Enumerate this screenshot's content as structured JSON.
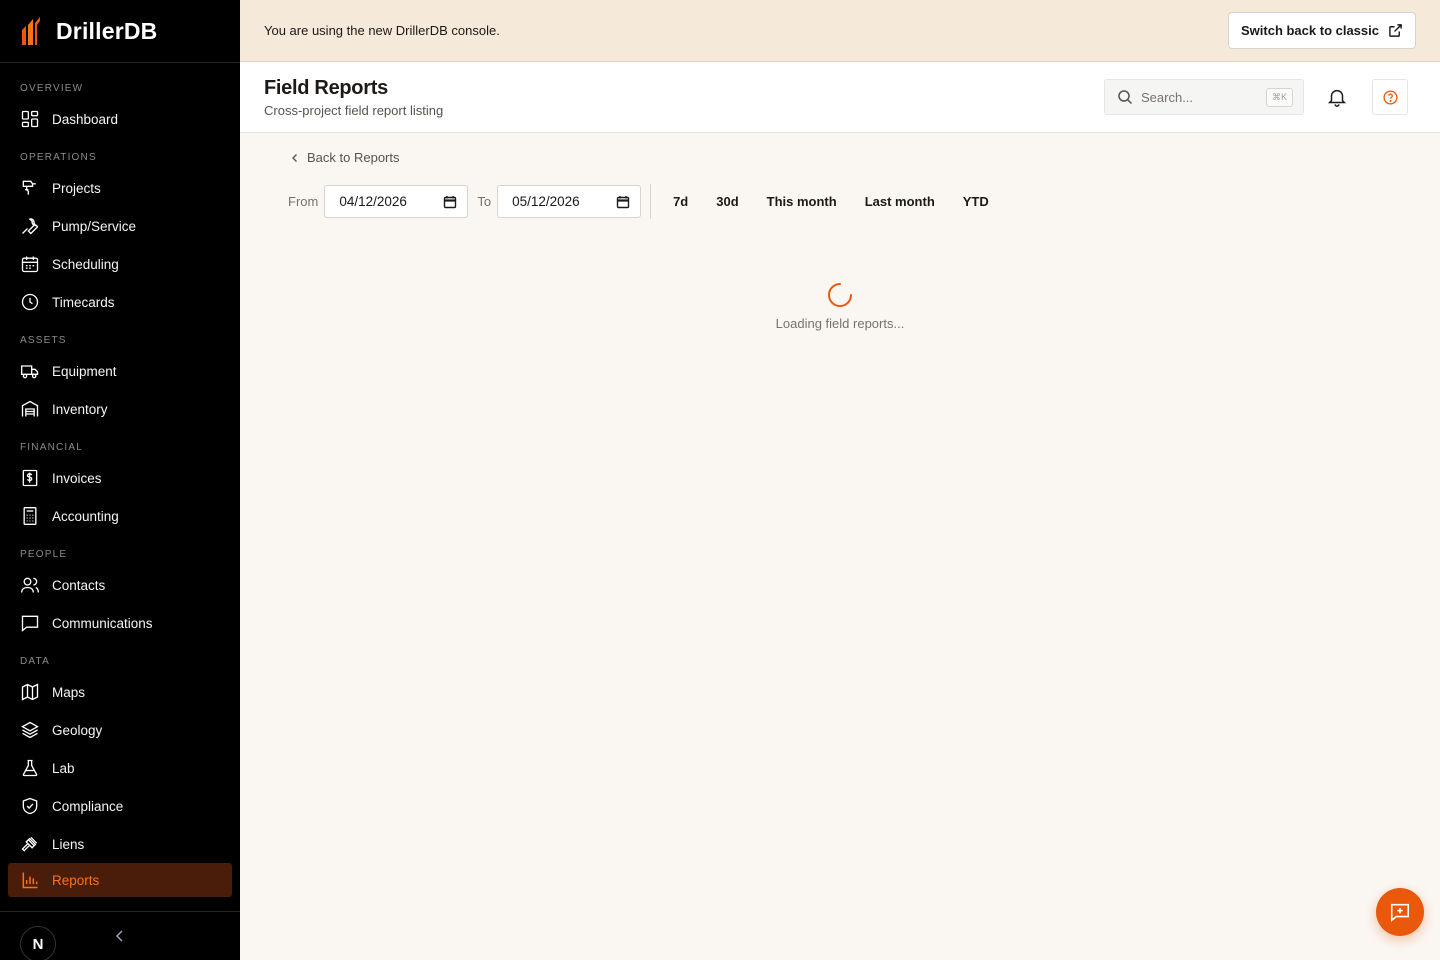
{
  "brand": {
    "name": "DrillerDB"
  },
  "sidebar": {
    "sections": [
      {
        "title": "OVERVIEW",
        "items": [
          {
            "label": "Dashboard",
            "icon": "dashboard-icon"
          }
        ]
      },
      {
        "title": "OPERATIONS",
        "items": [
          {
            "label": "Projects",
            "icon": "drill-icon"
          },
          {
            "label": "Pump/Service",
            "icon": "wrench-icon"
          },
          {
            "label": "Scheduling",
            "icon": "calendar-icon"
          },
          {
            "label": "Timecards",
            "icon": "clock-icon"
          }
        ]
      },
      {
        "title": "ASSETS",
        "items": [
          {
            "label": "Equipment",
            "icon": "truck-icon"
          },
          {
            "label": "Inventory",
            "icon": "warehouse-icon"
          }
        ]
      },
      {
        "title": "FINANCIAL",
        "items": [
          {
            "label": "Invoices",
            "icon": "invoice-icon"
          },
          {
            "label": "Accounting",
            "icon": "calculator-icon"
          }
        ]
      },
      {
        "title": "PEOPLE",
        "items": [
          {
            "label": "Contacts",
            "icon": "users-icon"
          },
          {
            "label": "Communications",
            "icon": "message-icon"
          }
        ]
      },
      {
        "title": "DATA",
        "items": [
          {
            "label": "Maps",
            "icon": "map-icon"
          },
          {
            "label": "Geology",
            "icon": "layers-icon"
          },
          {
            "label": "Lab",
            "icon": "flask-icon"
          },
          {
            "label": "Compliance",
            "icon": "shield-check-icon"
          },
          {
            "label": "Liens",
            "icon": "gavel-icon"
          },
          {
            "label": "Reports",
            "icon": "bar-chart-icon",
            "active": true
          }
        ]
      }
    ],
    "avatar_initial": "N"
  },
  "banner": {
    "text": "You are using the new DrillerDB console.",
    "button_label": "Switch back to classic"
  },
  "header": {
    "title": "Field Reports",
    "subtitle": "Cross-project field report listing",
    "search_placeholder": "Search...",
    "search_shortcut": "⌘K"
  },
  "content": {
    "back_label": "Back to Reports",
    "from_label": "From",
    "from_value": "04/12/2026",
    "to_label": "To",
    "to_value": "05/12/2026",
    "presets": [
      "7d",
      "30d",
      "This month",
      "Last month",
      "YTD"
    ],
    "loading_text": "Loading field reports..."
  },
  "colors": {
    "accent": "#ea580c",
    "sidebar_bg": "#000000",
    "banner_bg": "#f5e9d9",
    "page_bg": "#faf7f3"
  }
}
